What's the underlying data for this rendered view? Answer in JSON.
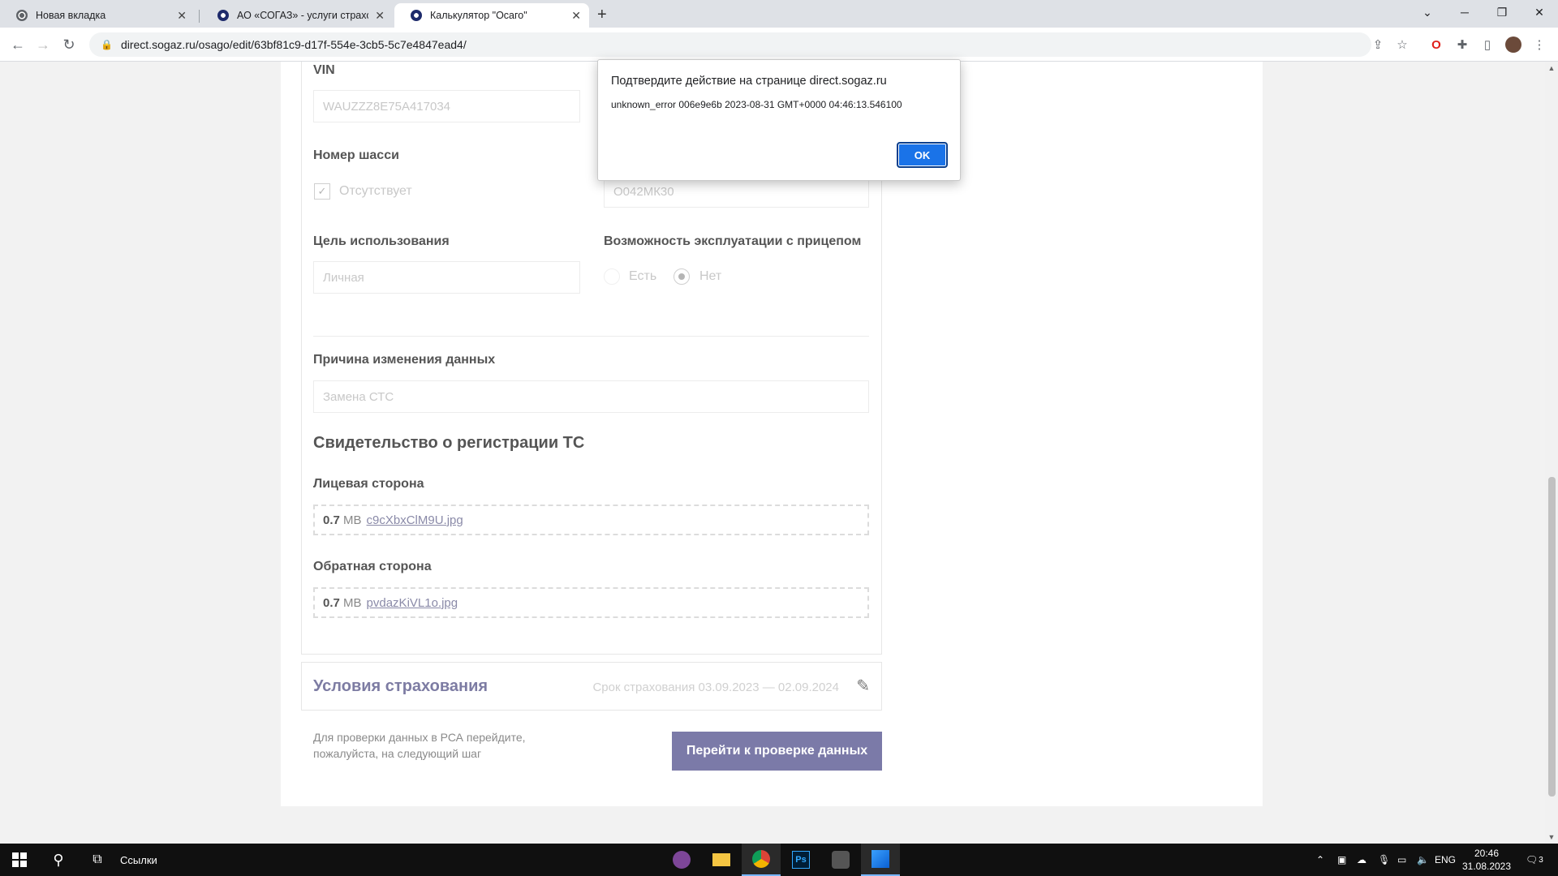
{
  "tabs": [
    {
      "title": "Новая вкладка",
      "icon": "chrome-icon"
    },
    {
      "title": "АО «СОГАЗ» - услуги страхован",
      "icon": "sogaz-icon"
    },
    {
      "title": "Калькулятор \"Осаго\"",
      "icon": "sogaz-icon"
    }
  ],
  "url": "direct.sogaz.ru/osago/edit/63bf81c9-d17f-554e-3cb5-5c7e4847ead4/",
  "form": {
    "vin_label": "VIN",
    "vin_value": "WAUZZZ8E75A417034",
    "chassis_label": "Номер шасси",
    "chassis_absent": "Отсутствует",
    "plate_value": "О042МК30",
    "purpose_label": "Цель использования",
    "purpose_value": "Личная",
    "trailer_label": "Возможность эксплуатации с прицепом",
    "trailer_yes": "Есть",
    "trailer_no": "Нет",
    "reason_label": "Причина изменения данных",
    "reason_value": "Замена СТС",
    "cert_title": "Свидетельство о регистрации ТС",
    "front_label": "Лицевая сторона",
    "front_size": "0.7",
    "front_unit": "MB",
    "front_file": "c9cXbxClM9U.jpg",
    "back_label": "Обратная сторона",
    "back_size": "0.7",
    "back_unit": "MB",
    "back_file": "pvdazKiVL1o.jpg"
  },
  "insurance": {
    "title": "Условия страхования",
    "period": "Срок страхования 03.09.2023 — 02.09.2024"
  },
  "hint": "Для проверки данных в РСА перейдите, пожалуйста, на следующий шаг",
  "cta": "Перейти к проверке данных",
  "dialog": {
    "title": "Подтвердите действие на странице direct.sogaz.ru",
    "message": "unknown_error 006e9e6b 2023-08-31 GMT+0000 04:46:13.546100",
    "ok": "OK"
  },
  "taskbar": {
    "links_label": "Ссылки",
    "lang": "ENG",
    "time": "20:46",
    "date": "31.08.2023",
    "notifications": "3"
  },
  "colors": {
    "accent": "#7b7aa8",
    "dialog_button": "#1a73e8"
  }
}
